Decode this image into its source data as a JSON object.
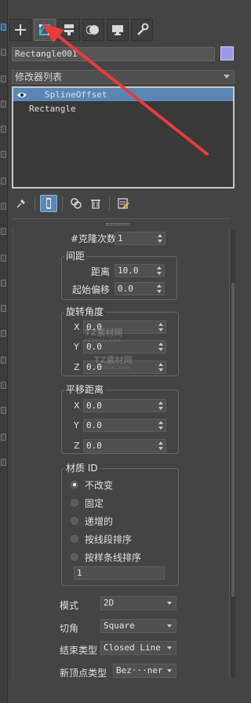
{
  "command_tabs": [
    {
      "icon": "plus-icon",
      "active": false
    },
    {
      "icon": "modify-icon",
      "active": true
    },
    {
      "icon": "hierarchy-icon",
      "active": false
    },
    {
      "icon": "motion-icon",
      "active": false
    },
    {
      "icon": "display-icon",
      "active": false
    },
    {
      "icon": "utilities-icon",
      "active": false
    }
  ],
  "object_name": "Rectangle001",
  "object_color": "#9a9ae6",
  "modifier_list_label": "修改器列表",
  "stack": {
    "items": [
      {
        "label": "SplineOffset",
        "selected": true
      },
      {
        "label": "Rectangle",
        "selected": false
      }
    ]
  },
  "stack_tools": [
    {
      "icon": "pin-icon",
      "active": false
    },
    {
      "icon": "show-end-result-icon",
      "active": true
    },
    {
      "icon": "make-unique-icon",
      "active": false
    },
    {
      "icon": "delete-modifier-icon",
      "active": false
    },
    {
      "icon": "configure-modifier-sets-icon",
      "active": false
    }
  ],
  "params": {
    "clone_count": {
      "label": "#克隆次数",
      "value": "1"
    },
    "spacing": {
      "title": "间距",
      "distance_label": "距离",
      "distance_value": "10.0",
      "start_offset_label": "起始偏移",
      "start_offset_value": "0.0"
    },
    "rotation": {
      "title": "旋转角度",
      "x_label": "X",
      "x_value": "0.0",
      "y_label": "Y",
      "y_value": "0.0",
      "z_label": "Z",
      "z_value": "0.0"
    },
    "translation": {
      "title": "平移距离",
      "x_label": "X",
      "x_value": "0.0",
      "y_label": "Y",
      "y_value": "0.0",
      "z_label": "Z",
      "z_value": "0.0"
    },
    "material_id": {
      "title": "材质 ID",
      "options": [
        "不改变",
        "固定",
        "递增的",
        "按线段排序",
        "按样条线排序"
      ],
      "selected_index": 0,
      "value": "1"
    },
    "mode": {
      "label": "模式",
      "value": "2D"
    },
    "chamfer": {
      "label": "切角",
      "value": "Square"
    },
    "end_type": {
      "label": "结束类型",
      "value": "Closed Line"
    },
    "new_vertex_type": {
      "label": "新顶点类型",
      "value": "Bez···ner"
    }
  },
  "watermark": {
    "text": "TZ素材网",
    "sub": "TZSUCAI.COM"
  },
  "annotation_color": "#e83c3c"
}
